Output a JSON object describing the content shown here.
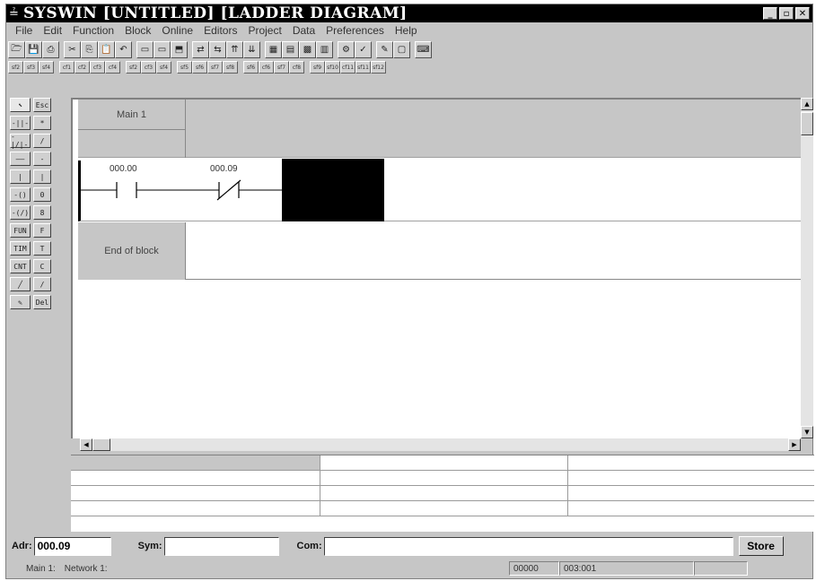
{
  "window": {
    "title": "SYSWIN [UNTITLED] [LADDER DIAGRAM]",
    "app_icon": "ladder-app-icon",
    "controls": [
      "_",
      "▫",
      "✕"
    ]
  },
  "menu": [
    "File",
    "Edit",
    "Function",
    "Block",
    "Online",
    "Editors",
    "Project",
    "Data",
    "Preferences",
    "Help"
  ],
  "toolbar": {
    "groups": [
      [
        {
          "icon": "open-file-icon",
          "glyph": "🗁"
        },
        {
          "icon": "save-icon",
          "glyph": "💾"
        },
        {
          "icon": "print-icon",
          "glyph": "⎙"
        }
      ],
      [
        {
          "icon": "cut-icon",
          "glyph": "✂"
        },
        {
          "icon": "copy-icon",
          "glyph": "⎘"
        },
        {
          "icon": "paste-icon",
          "glyph": "📋"
        },
        {
          "icon": "undo-icon",
          "glyph": "↶"
        }
      ],
      [
        {
          "icon": "insert-row-icon",
          "glyph": "▭"
        },
        {
          "icon": "delete-row-icon",
          "glyph": "▭"
        },
        {
          "icon": "block-icon",
          "glyph": "⬒"
        }
      ],
      [
        {
          "icon": "online-icon",
          "glyph": "⇄"
        },
        {
          "icon": "monitor-icon",
          "glyph": "⇆"
        },
        {
          "icon": "transfer-up-icon",
          "glyph": "⇈"
        },
        {
          "icon": "transfer-down-icon",
          "glyph": "⇊"
        }
      ],
      [
        {
          "icon": "chart-icon",
          "glyph": "▦"
        },
        {
          "icon": "table-icon",
          "glyph": "▤"
        },
        {
          "icon": "memory-icon",
          "glyph": "▩"
        },
        {
          "icon": "io-icon",
          "glyph": "▥"
        }
      ],
      [
        {
          "icon": "compile-icon",
          "glyph": "⚙"
        },
        {
          "icon": "check-icon",
          "glyph": "✓"
        }
      ],
      [
        {
          "icon": "pen-icon",
          "glyph": "✎"
        },
        {
          "icon": "zoom-icon",
          "glyph": "▢"
        }
      ],
      [
        {
          "icon": "keyboard-icon",
          "glyph": "⌨"
        }
      ]
    ]
  },
  "function_keys": [
    [
      "sf2",
      "sf3",
      "sf4"
    ],
    [
      "cf1",
      "cf2",
      "cf3",
      "cf4"
    ],
    [
      "sf2",
      "cf3",
      "sf4"
    ],
    [
      "sf5",
      "sf6",
      "sf7",
      "sf8"
    ],
    [
      "sf6",
      "cf6",
      "sf7",
      "cf8"
    ],
    [
      "sf9",
      "sf10",
      "cf11",
      "sf11",
      "sf12"
    ]
  ],
  "palette": [
    {
      "tool": "select-pointer-icon",
      "label": "⬉",
      "key": "Esc"
    },
    {
      "tool": "contact-no-icon",
      "label": "-||-",
      "key": "*"
    },
    {
      "tool": "contact-nc-icon",
      "label": "-|/|-",
      "key": "/"
    },
    {
      "tool": "horizontal-line-icon",
      "label": "——",
      "key": "-"
    },
    {
      "tool": "vertical-line-icon",
      "label": "|",
      "key": "|"
    },
    {
      "tool": "coil-icon",
      "label": "-()",
      "key": "0"
    },
    {
      "tool": "coil-nc-icon",
      "label": "-(/)",
      "key": "8"
    },
    {
      "tool": "function-icon",
      "label": "FUN",
      "key": "F"
    },
    {
      "tool": "timer-icon",
      "label": "TIM",
      "key": "T"
    },
    {
      "tool": "counter-icon",
      "label": "CNT",
      "key": "C"
    },
    {
      "tool": "draw-line-icon",
      "label": "╱",
      "key": "/"
    },
    {
      "tool": "edit-network-icon",
      "label": "✎",
      "key": "Del"
    }
  ],
  "ladder": {
    "block_name": "Main 1",
    "rung": {
      "contacts": [
        {
          "address": "000.00",
          "type": "normally-open"
        },
        {
          "address": "000.09",
          "type": "normally-closed"
        }
      ]
    },
    "end_label": "End of block"
  },
  "address_bar": {
    "adr_label": "Adr:",
    "adr_value": "000.09",
    "sym_label": "Sym:",
    "sym_value": "",
    "com_label": "Com:",
    "com_value": "",
    "store_label": "Store"
  },
  "status": {
    "block": "Main 1:",
    "network": "Network 1:",
    "step": "00000",
    "position": "003:001"
  }
}
